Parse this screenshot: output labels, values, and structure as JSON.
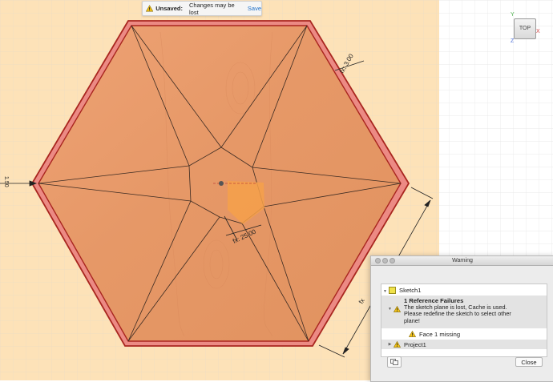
{
  "notification": {
    "unsaved_label": "Unsaved:",
    "message": "Changes may be lost",
    "save_label": "Save"
  },
  "viewcube": {
    "face_label": "TOP",
    "axis_y": "Y",
    "axis_x": "X",
    "axis_z": "Z"
  },
  "dimensions": {
    "top_edge": "fx: 3.00",
    "inner": "fx: 25.00",
    "left_edge": "1.50",
    "right_partial": "fx"
  },
  "warning_dialog": {
    "title": "Warning",
    "tree": {
      "sketch": "Sketch1",
      "failure_title": "1 Reference Failures",
      "failure_desc": [
        "The sketch plane is lost, Cache is used.",
        "Please redefine the sketch to select other",
        "plane!"
      ],
      "face_missing": "Face 1 missing",
      "project": "Project1"
    },
    "close_label": "Close"
  },
  "colors": {
    "canvas_bg": "#fde2b8",
    "wood": "#e89c6c",
    "border_outer": "#b3302c",
    "border_fill": "#ec8a84",
    "warning_yellow": "#f3c318",
    "selection": "#f6a04a"
  }
}
